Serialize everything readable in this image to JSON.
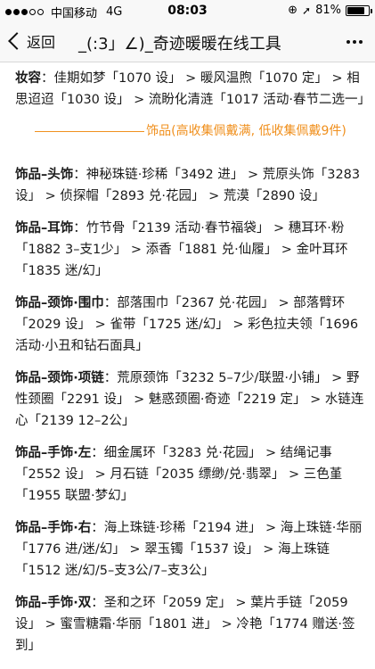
{
  "status_bar": {
    "carrier": "中国移动",
    "network": "4G",
    "time": "08:03",
    "battery": "81%",
    "battery_level": 0.81
  },
  "nav": {
    "back_label": "返回",
    "title": "_(:3」∠)_奇迹暖暖在线工具"
  },
  "content": {
    "makeup": {
      "label": "妆容",
      "text": "：佳期如梦「1070 设」 > 暖风温煦「1070 定」 > 相思迢迢「1030 设」 > 流盼化清涟「1017 活动·春节二选一」"
    },
    "divider_text": "饰品(高收集佩戴满, 低收集佩戴9件)",
    "sections": [
      {
        "label": "饰品–头饰",
        "text": "：神秘珠链·珍稀「3492 进」 > 荒原头饰「3283 设」 > 侦探帽「2893 兑·花园」 > 荒漠「2890 设」"
      },
      {
        "label": "饰品–耳饰",
        "text": "：竹节骨「2139 活动·春节福袋」 > 穗耳环·粉「1882 3–支1少」 > 添香「1881 兑·仙履」 > 金叶耳环「1835 迷/幻」"
      },
      {
        "label": "饰品–颈饰·围巾",
        "text": "：部落围巾「2367 兑·花园」 > 部落臂环「2029 设」 > 雀带「1725 迷/幻」 > 彩色拉夫领「1696 活动·小丑和钻石面具」"
      },
      {
        "label": "饰品–颈饰·项链",
        "text": "：荒原颈饰「3232 5–7少/联盟·小铺」 > 野性颈圈「2291 设」 > 魅惑颈圈·奇迹「2219 定」 > 水链连心「2139 12–2公」"
      },
      {
        "label": "饰品–手饰·左",
        "text": "：细金属环「3283 兑·花园」 > 结绳记事「2552 设」 > 月石链「2035 缥缈/兑·翡翠」 > 三色堇「1955 联盟·梦幻」"
      },
      {
        "label": "饰品–手饰·右",
        "text": "：海上珠链·珍稀「2194 进」 > 海上珠链·华丽「1776 进/迷/幻」 > 翠玉镯「1537 设」 > 海上珠链「1512 迷/幻/5–支3公/7–支3公」"
      },
      {
        "label": "饰品–手饰·双",
        "text": "：圣和之环「2059 定」 > 葉片手链「2059 设」 > 蜜雪糖霜·华丽「1801 进」 > 冷艳「1774 赠送·签到」"
      }
    ]
  }
}
